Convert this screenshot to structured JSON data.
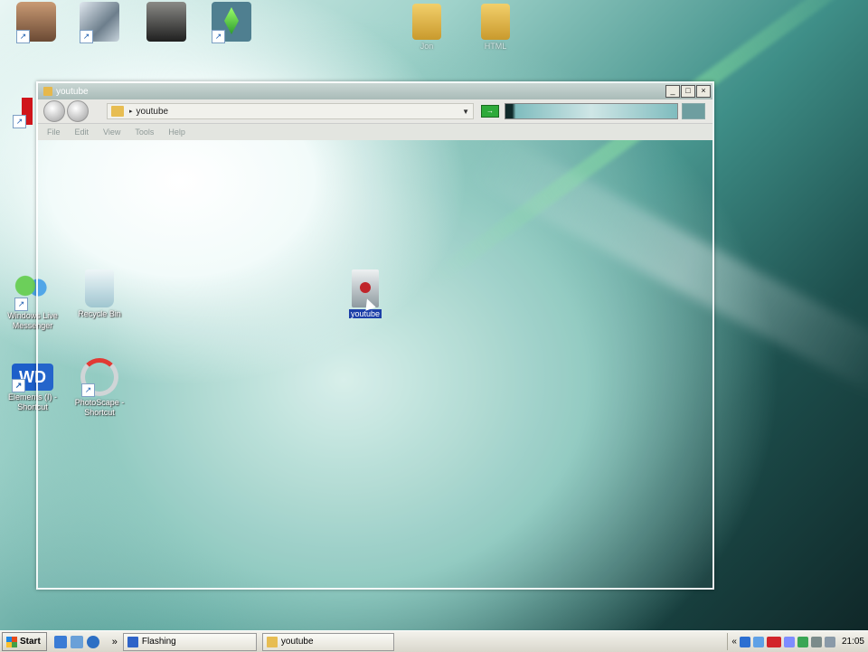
{
  "desktop": {
    "top_icons": [
      {
        "id": "person",
        "label": ""
      },
      {
        "id": "game",
        "label": ""
      },
      {
        "id": "soldier",
        "label": ""
      },
      {
        "id": "sims",
        "label": ""
      }
    ],
    "folders": [
      {
        "label": "Jon"
      },
      {
        "label": "HTML"
      }
    ],
    "left_icons": [
      {
        "label": "Windows Live Messenger"
      },
      {
        "label": "Recycle Bin"
      },
      {
        "label": "Elements (I) - Shortcut"
      },
      {
        "label": "PhotoScape - Shortcut"
      }
    ],
    "dragged_folder": {
      "label": "youtube"
    }
  },
  "window": {
    "title": "youtube",
    "address": "youtube",
    "menu": [
      "File",
      "Edit",
      "View",
      "Tools",
      "Help"
    ],
    "buttons": {
      "minimize": "_",
      "maximize": "□",
      "close": "×"
    }
  },
  "taskbar": {
    "start_label": "Start",
    "chevron": "»",
    "tasks": [
      {
        "label": "Flashing"
      },
      {
        "label": "youtube"
      }
    ],
    "tray_chevron": "«",
    "clock": "21:05"
  },
  "colors": {
    "folder": "#e7bd52",
    "go": "#2eaa3a",
    "selection": "#1c3fa8"
  }
}
